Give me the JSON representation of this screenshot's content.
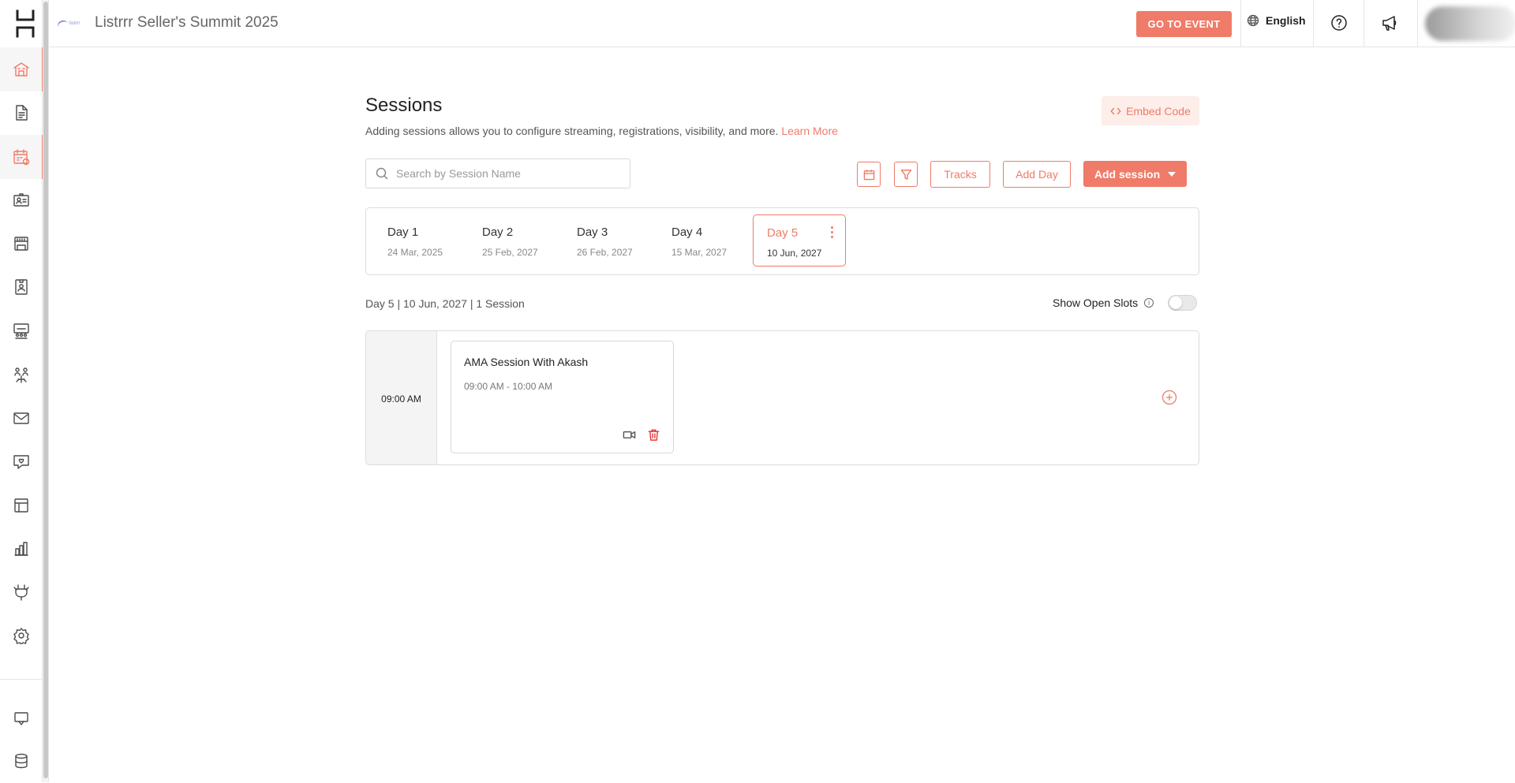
{
  "app": {
    "event_title": "Listrrr Seller's Summit 2025",
    "event_logo_text": "listrrr"
  },
  "topbar": {
    "go_to_event_label": "GO TO EVENT",
    "language_label": "English",
    "accent_color": "#ef7b68"
  },
  "sidebar": {
    "items": [
      {
        "icon": "venue-icon",
        "active": true
      },
      {
        "icon": "document-icon",
        "active": false
      },
      {
        "icon": "calendar-sessions-icon",
        "active": true
      },
      {
        "icon": "attendees-id-icon",
        "active": false
      },
      {
        "icon": "booth-icon",
        "active": false
      },
      {
        "icon": "badge-icon",
        "active": false
      },
      {
        "icon": "rooms-icon",
        "active": false
      },
      {
        "icon": "networking-icon",
        "active": false
      },
      {
        "icon": "mail-icon",
        "active": false
      },
      {
        "icon": "engagement-icon",
        "active": false
      },
      {
        "icon": "layout-icon",
        "active": false
      },
      {
        "icon": "analytics-icon",
        "active": false
      },
      {
        "icon": "integrations-icon",
        "active": false
      },
      {
        "icon": "settings-icon",
        "active": false
      },
      {
        "icon": "chat-support-icon",
        "active": false
      },
      {
        "icon": "database-icon",
        "active": false
      }
    ]
  },
  "page": {
    "title": "Sessions",
    "subtitle": "Adding sessions allows you to configure streaming, registrations, visibility, and more.",
    "learn_more": "Learn More",
    "embed_code_label": "Embed Code"
  },
  "toolbar": {
    "search_placeholder": "Search by Session Name",
    "tracks_label": "Tracks",
    "add_day_label": "Add Day",
    "add_session_label": "Add session"
  },
  "days": [
    {
      "name": "Day 1",
      "date": "24 Mar, 2025",
      "active": false
    },
    {
      "name": "Day 2",
      "date": "25 Feb, 2027",
      "active": false
    },
    {
      "name": "Day 3",
      "date": "26 Feb, 2027",
      "active": false
    },
    {
      "name": "Day 4",
      "date": "15 Mar, 2027",
      "active": false
    },
    {
      "name": "Day 5",
      "date": "10 Jun, 2027",
      "active": true
    }
  ],
  "schedule": {
    "summary": "Day 5 | 10 Jun, 2027 | 1 Session",
    "show_open_slots_label": "Show Open Slots",
    "show_open_slots_on": false,
    "slots": [
      {
        "time": "09:00 AM",
        "sessions": [
          {
            "title": "AMA Session With Akash",
            "time_range": "09:00 AM - 10:00 AM"
          }
        ]
      }
    ]
  }
}
